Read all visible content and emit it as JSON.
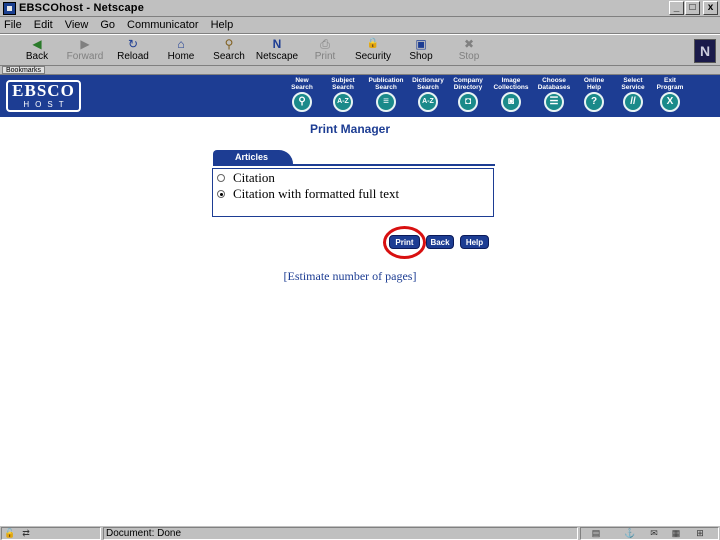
{
  "window": {
    "title": "EBSCOhost - Netscape",
    "controls": [
      "_",
      "□",
      "x"
    ]
  },
  "menu": [
    "File",
    "Edit",
    "View",
    "Go",
    "Communicator",
    "Help"
  ],
  "toolbar": [
    {
      "label": "Back",
      "icon": "back-arrow-icon",
      "glyph": "◀"
    },
    {
      "label": "Forward",
      "icon": "forward-arrow-icon",
      "glyph": "▶"
    },
    {
      "label": "Reload",
      "icon": "reload-icon",
      "glyph": "↻"
    },
    {
      "label": "Home",
      "icon": "home-icon",
      "glyph": "⌂"
    },
    {
      "label": "Search",
      "icon": "search-icon",
      "glyph": "⚲"
    },
    {
      "label": "Netscape",
      "icon": "netscape-icon",
      "glyph": "N"
    },
    {
      "label": "Print",
      "icon": "print-icon",
      "glyph": "⎙"
    },
    {
      "label": "Security",
      "icon": "lock-icon",
      "glyph": "🔒"
    },
    {
      "label": "Shop",
      "icon": "shop-icon",
      "glyph": "▣"
    },
    {
      "label": "Stop",
      "icon": "stop-icon",
      "glyph": "✖"
    }
  ],
  "location_tag": "Bookmarks",
  "ebsco": {
    "logo_top": "EBSCO",
    "logo_bottom": "HOST",
    "nav": [
      {
        "label": "New\nSearch",
        "icon": "magnifier-icon",
        "glyph": "⚲"
      },
      {
        "label": "Subject\nSearch",
        "icon": "az-icon",
        "glyph": "A-Z"
      },
      {
        "label": "Publication\nSearch",
        "icon": "book-icon",
        "glyph": "≡"
      },
      {
        "label": "Dictionary\nSearch",
        "icon": "dictionary-az-icon",
        "glyph": "A-Z"
      },
      {
        "label": "Company\nDirectory",
        "icon": "company-icon",
        "glyph": "◘"
      },
      {
        "label": "Image\nCollections",
        "icon": "camera-icon",
        "glyph": "◙"
      },
      {
        "label": "Choose\nDatabases",
        "icon": "databases-icon",
        "glyph": "☰"
      },
      {
        "label": "Online\nHelp",
        "icon": "question-icon",
        "glyph": "?"
      },
      {
        "label": "Select\nService",
        "icon": "service-icon",
        "glyph": "//"
      },
      {
        "label": "Exit\nProgram",
        "icon": "exit-x-icon",
        "glyph": "X"
      }
    ]
  },
  "main": {
    "title": "Print Manager",
    "tab": "Articles",
    "options": [
      {
        "label": "Citation",
        "checked": false
      },
      {
        "label": "Citation with formatted full text",
        "checked": true
      }
    ],
    "buttons": {
      "print": "Print",
      "back": "Back",
      "help": "Help"
    },
    "estimate_link": "[Estimate number of pages]"
  },
  "status": {
    "text": "Document: Done"
  },
  "colors": {
    "ebsco_blue": "#1d3d93",
    "nav_teal": "#1a8a8a",
    "highlight_red": "#d81010"
  }
}
